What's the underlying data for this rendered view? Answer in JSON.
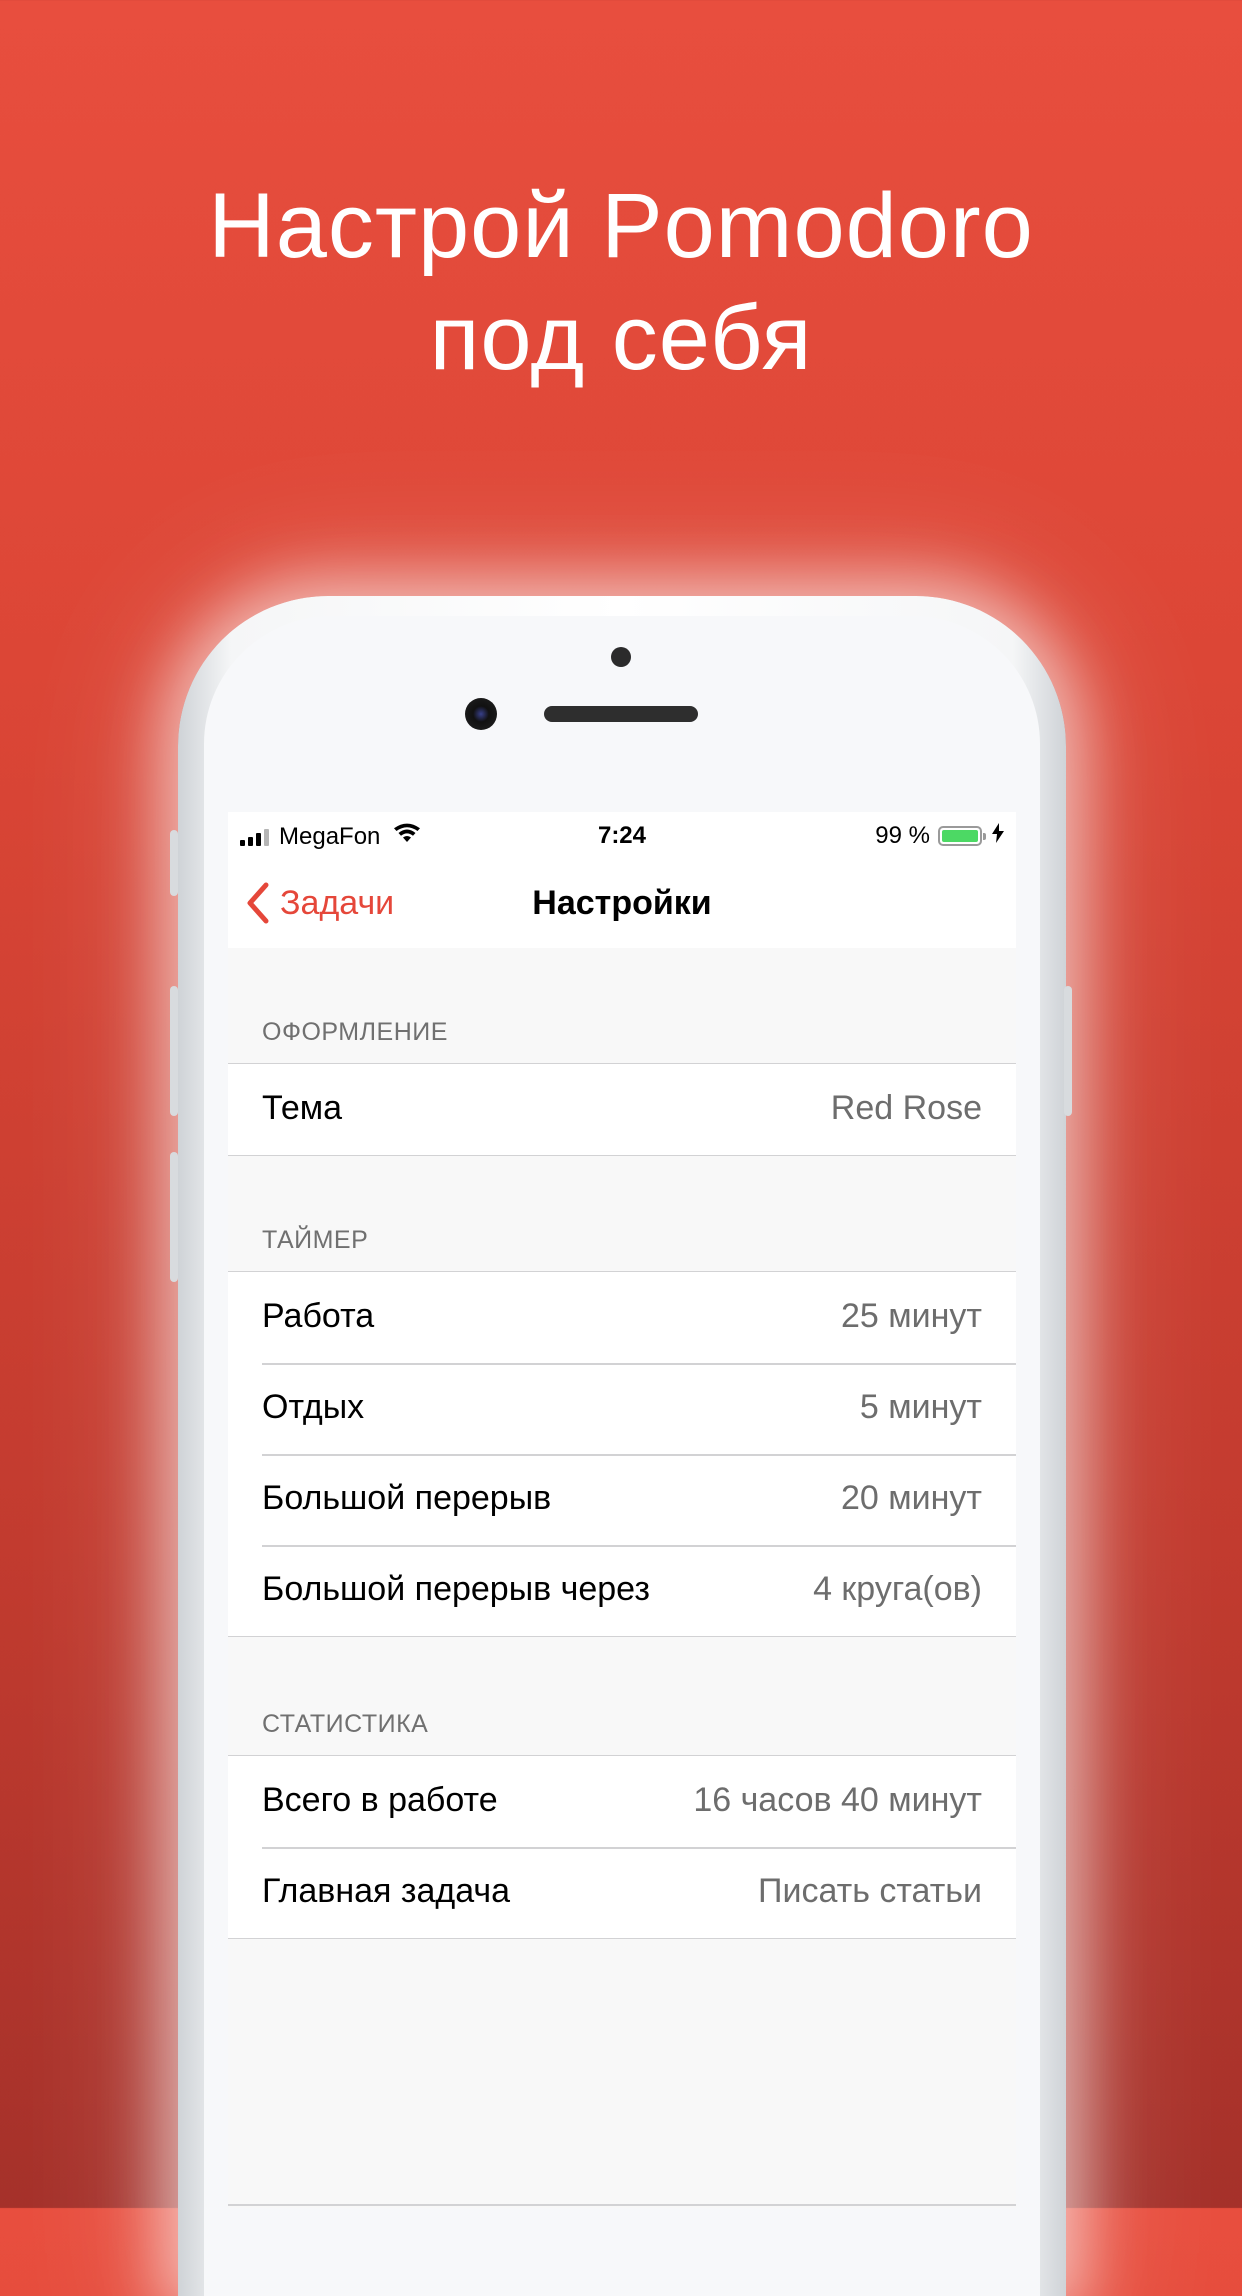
{
  "headline": [
    "Настрой Pomodoro",
    "под себя"
  ],
  "status_bar": {
    "carrier": "MegaFon",
    "time": "7:24",
    "battery": "99 %",
    "battery_color": "#4cd964"
  },
  "nav": {
    "back_label": "Задачи",
    "title": "Настройки",
    "accent_color": "#e5473a"
  },
  "sections": [
    {
      "header": "ОФОРМЛЕНИЕ",
      "rows": [
        {
          "label": "Тема",
          "value": "Red Rose"
        }
      ]
    },
    {
      "header": "ТАЙМЕР",
      "rows": [
        {
          "label": "Работа",
          "value": "25 минут"
        },
        {
          "label": "Отдых",
          "value": "5 минут"
        },
        {
          "label": "Большой перерыв",
          "value": "20 минут"
        },
        {
          "label": "Большой перерыв через",
          "value": "4 круга(ов)"
        }
      ]
    },
    {
      "header": "СТАТИСТИКА",
      "rows": [
        {
          "label": "Всего в работе",
          "value": "16 часов 40 минут"
        },
        {
          "label": "Главная задача",
          "value": "Писать статьи"
        }
      ]
    }
  ]
}
